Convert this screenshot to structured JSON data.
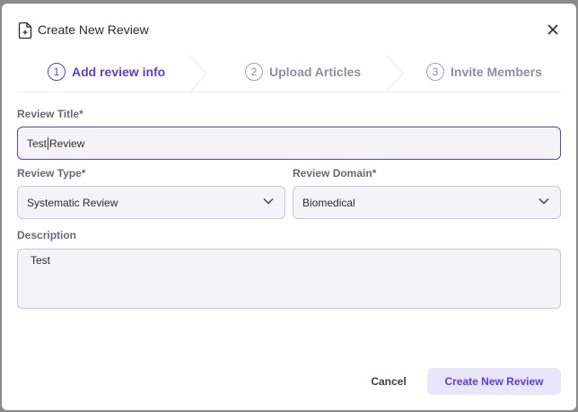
{
  "dialog": {
    "title": "Create New Review",
    "close_icon": "close-icon",
    "doc_icon": "document-add-icon"
  },
  "stepper": {
    "steps": [
      {
        "number": "1",
        "label": "Add review info",
        "state": "active"
      },
      {
        "number": "2",
        "label": "Upload Articles",
        "state": "inactive"
      },
      {
        "number": "3",
        "label": "Invite Members",
        "state": "inactive"
      }
    ]
  },
  "form": {
    "review_title": {
      "label": "Review Title*",
      "value_before_caret": "Test",
      "value_after_caret": "Review"
    },
    "review_type": {
      "label": "Review Type*",
      "value": "Systematic Review"
    },
    "review_domain": {
      "label": "Review Domain*",
      "value": "Biomedical"
    },
    "description": {
      "label": "Description",
      "value": "Test"
    }
  },
  "actions": {
    "cancel_label": "Cancel",
    "create_label": "Create New Review"
  },
  "colors": {
    "accent": "#5a3fd9",
    "accent_light": "#e9e6fb",
    "inactive": "#8a90a6",
    "field_bg": "#f4f4f8"
  }
}
